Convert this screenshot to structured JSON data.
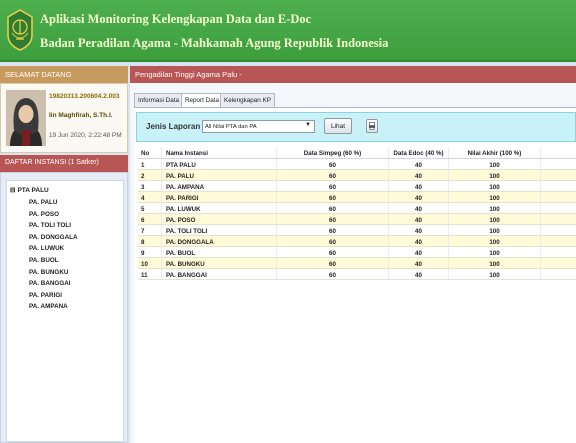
{
  "header": {
    "app_title": "Aplikasi Monitoring Kelengkapan Data dan E-Doc",
    "subtitle": "Badan Peradilan Agama - Mahkamah Agung Republik Indonesia",
    "logo_icon": "court-emblem-icon"
  },
  "welcome": {
    "title": "SELAMAT DATANG",
    "nip": "19820313.200604.2.003",
    "name": "Iin Maghfirah, S.Th.I.",
    "login_time": "19 Jun 2020, 2:22:48 PM"
  },
  "instansi": {
    "title": "DAFTAR INSTANSI (1 Satker)",
    "root": {
      "toggle": "⊟",
      "label": "PTA PALU"
    },
    "children": [
      "PA. PALU",
      "PA. POSO",
      "PA. TOLI TOLI",
      "PA. DONGGALA",
      "PA. LUWUK",
      "PA. BUOL",
      "PA. BUNGKU",
      "PA. BANGGAI",
      "PA. PARIGI",
      "PA. AMPANA"
    ]
  },
  "main": {
    "title": "Pengadilan Tinggi Agama Palu -",
    "tabs": [
      {
        "label": "Informasi Data",
        "active": false
      },
      {
        "label": "Report Data",
        "active": true
      },
      {
        "label": "Kelengkapan KP",
        "active": false
      }
    ],
    "filter": {
      "label": "Jenis Laporan",
      "selected": "All Nilai PTA dan PA",
      "button": "Lihat",
      "print_icon": "print-icon"
    },
    "table": {
      "headers": [
        "No",
        "Nama Instansi",
        "Data Simpeg (60 %)",
        "Data Edoc (40 %)",
        "Nilai Akhir (100 %)"
      ],
      "rows": [
        [
          "1",
          "PTA PALU",
          "60",
          "40",
          "100"
        ],
        [
          "2",
          "PA. PALU",
          "60",
          "40",
          "100"
        ],
        [
          "3",
          "PA. AMPANA",
          "60",
          "40",
          "100"
        ],
        [
          "4",
          "PA. PARIGI",
          "60",
          "40",
          "100"
        ],
        [
          "5",
          "PA. LUWUK",
          "60",
          "40",
          "100"
        ],
        [
          "6",
          "PA. POSO",
          "60",
          "40",
          "100"
        ],
        [
          "7",
          "PA. TOLI TOLI",
          "60",
          "40",
          "100"
        ],
        [
          "8",
          "PA. DONGGALA",
          "60",
          "40",
          "100"
        ],
        [
          "9",
          "PA. BUOL",
          "60",
          "40",
          "100"
        ],
        [
          "10",
          "PA. BUNGKU",
          "60",
          "40",
          "100"
        ],
        [
          "11",
          "PA. BANGGAI",
          "60",
          "40",
          "100"
        ]
      ]
    }
  },
  "colors": {
    "header_green": "#3d9e3d",
    "welcome_tan": "#c79b5f",
    "panel_red": "#b85555",
    "filter_cyan": "#c8f2f8",
    "row_alt": "#fffbd8"
  }
}
